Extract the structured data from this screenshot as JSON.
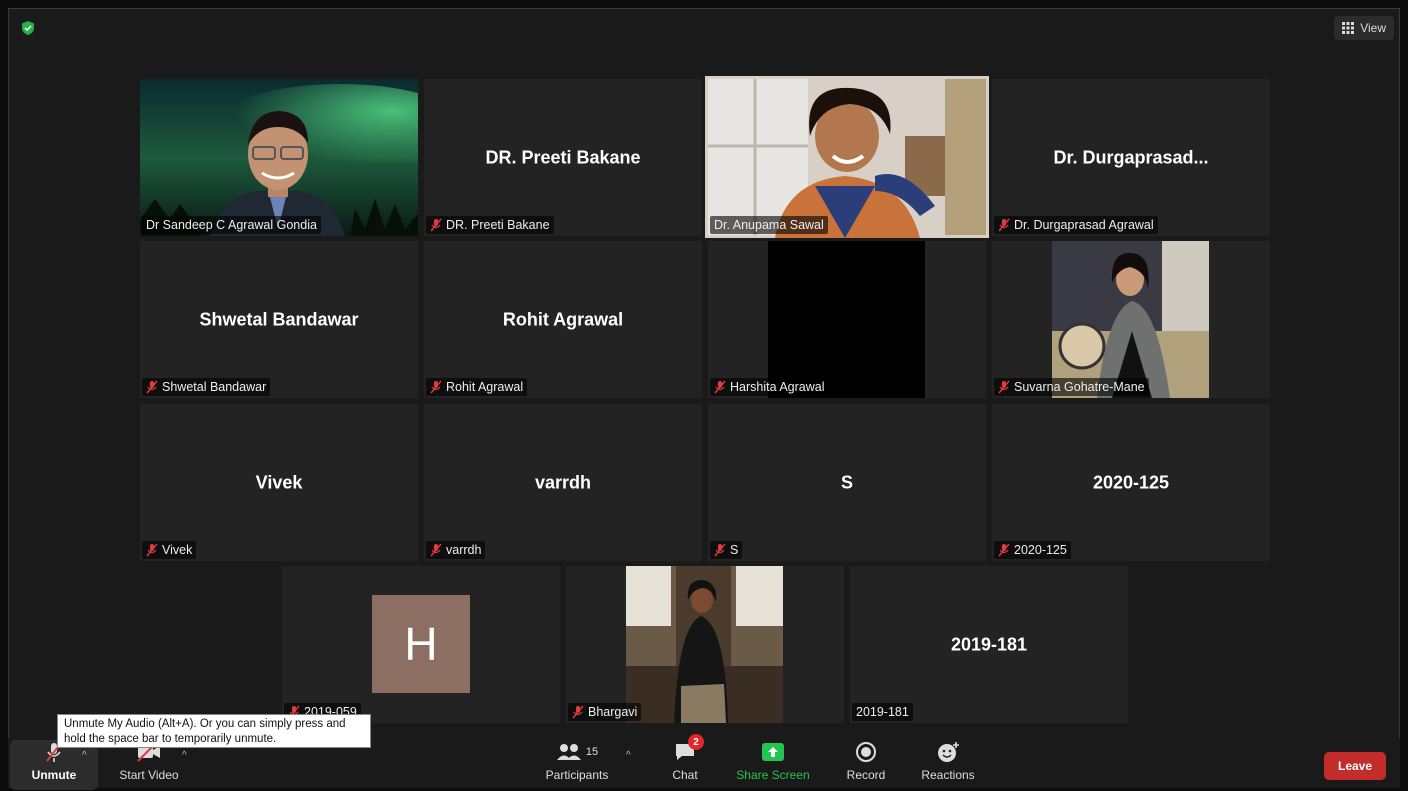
{
  "header": {
    "view_label": "View",
    "security_icon": "shield-check-icon",
    "colors": {
      "secure": "#23b246",
      "active_speaker": "#c5e65a"
    }
  },
  "participants": {
    "sandeep": {
      "label": "Dr Sandeep C Agrawal Gondia"
    },
    "preeti": {
      "name": "DR. Preeti Bakane",
      "label": "DR. Preeti Bakane"
    },
    "anupama": {
      "label": "Dr. Anupama Sawal"
    },
    "durgaprasad": {
      "name": "Dr. Durgaprasad...",
      "label": "Dr. Durgaprasad Agrawal"
    },
    "shwetal": {
      "name": "Shwetal Bandawar",
      "label": "Shwetal Bandawar"
    },
    "rohit": {
      "name": "Rohit Agrawal",
      "label": "Rohit Agrawal"
    },
    "harshita": {
      "label": "Harshita Agrawal"
    },
    "suvarna": {
      "label": "Suvarna Gohatre-Mane"
    },
    "vivek": {
      "name": "Vivek",
      "label": "Vivek"
    },
    "varrdh": {
      "name": "varrdh",
      "label": "varrdh"
    },
    "s": {
      "name": "S",
      "label": "S"
    },
    "p2020": {
      "name": "2020-125",
      "label": "2020-125"
    },
    "p2019059": {
      "avatar_letter": "H",
      "label": "2019-059"
    },
    "bhargavi": {
      "label": "Bhargavi"
    },
    "p2019181": {
      "name": "2019-181",
      "label": "2019-181"
    }
  },
  "toolbar": {
    "unmute": "Unmute",
    "start_video": "Start Video",
    "participants": "Participants",
    "participants_count": "15",
    "chat": "Chat",
    "chat_badge": "2",
    "share_screen": "Share Screen",
    "record": "Record",
    "reactions": "Reactions",
    "leave": "Leave",
    "colors": {
      "share": "#23c552",
      "leave": "#c42b2b",
      "badge": "#e02828"
    }
  },
  "tooltip": {
    "text": "Unmute My Audio (Alt+A). Or you can simply press and hold the space bar to temporarily unmute."
  }
}
